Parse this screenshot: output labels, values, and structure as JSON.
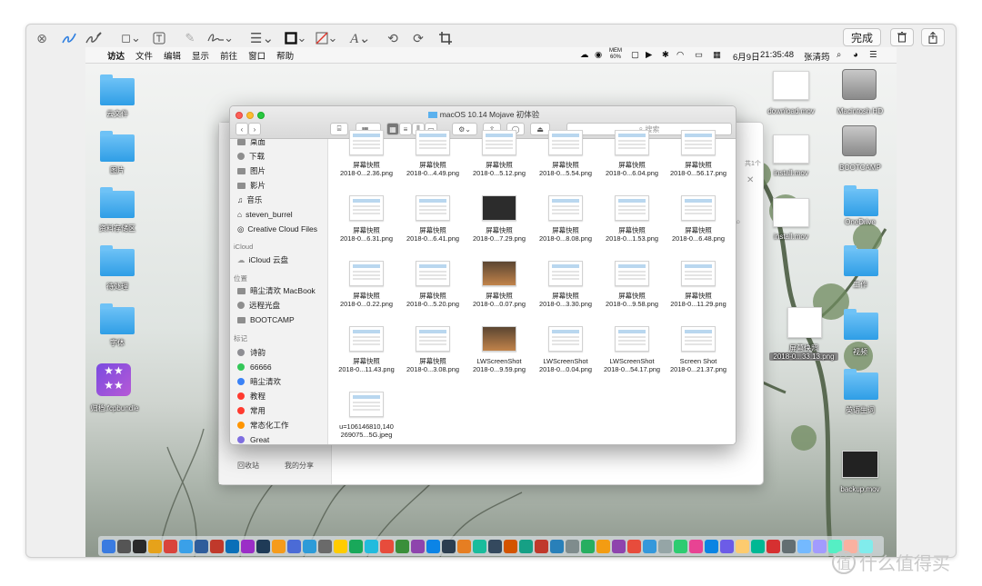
{
  "toolbar": {
    "done_label": "完成"
  },
  "menubar": {
    "items": [
      "访达",
      "文件",
      "编辑",
      "显示",
      "前往",
      "窗口",
      "帮助"
    ],
    "mem_top": "MEM",
    "mem_pct": "60%",
    "date": "6月9日",
    "time": "21:35:48",
    "user": "张清筠"
  },
  "desktop": {
    "left_icons": [
      {
        "label": "云文件"
      },
      {
        "label": "图片"
      },
      {
        "label": "资料存储区"
      },
      {
        "label": "待处理"
      },
      {
        "label": "字体"
      },
      {
        "label": "归档.fcpbundle"
      }
    ],
    "right_items": [
      {
        "label": "download.mov"
      },
      {
        "label": "Macintosh HD"
      },
      {
        "label": "install.mov"
      },
      {
        "label": "BOOTCAMP"
      },
      {
        "label": "install.mov"
      },
      {
        "label": "OneDrive"
      },
      {
        "label": "工作"
      },
      {
        "label": "屏幕快照"
      },
      {
        "label": "2018-0...33.13.png"
      },
      {
        "label": "视频"
      },
      {
        "label": "英语生词"
      },
      {
        "label": "backup.mov"
      }
    ]
  },
  "bg_window": {
    "side_footer": [
      "回收站",
      "我的分享"
    ],
    "count_text": "共1个"
  },
  "finder": {
    "title": "macOS 10.14 Mojave 初体验",
    "search_placeholder": "搜索",
    "sidebar": {
      "favorites": [
        "桌面",
        "下载",
        "图片",
        "影片",
        "音乐",
        "steven_burrel",
        "Creative Cloud Files"
      ],
      "icloud_header": "iCloud",
      "icloud": [
        "iCloud 云盘"
      ],
      "locations_header": "位置",
      "locations": [
        "暗尘清欢 MacBook",
        "远程光盘",
        "BOOTCAMP"
      ],
      "tags_header": "标记",
      "tags": [
        {
          "name": "诗韵",
          "color": "#8e8e93"
        },
        {
          "name": "66666",
          "color": "#34c759"
        },
        {
          "name": "暗尘清欢",
          "color": "#3b82f6"
        },
        {
          "name": "教程",
          "color": "#ff3b30"
        },
        {
          "name": "常用",
          "color": "#ff3b30"
        },
        {
          "name": "常态化工作",
          "color": "#ff9500"
        },
        {
          "name": "Great",
          "color": "#7e6ee0"
        }
      ]
    },
    "files": [
      {
        "name": "屏幕快照",
        "sub": "2018-0...2.36.png"
      },
      {
        "name": "屏幕快照",
        "sub": "2018-0...4.49.png"
      },
      {
        "name": "屏幕快照",
        "sub": "2018-0...5.12.png"
      },
      {
        "name": "屏幕快照",
        "sub": "2018-0...5.54.png"
      },
      {
        "name": "屏幕快照",
        "sub": "2018-0...6.04.png"
      },
      {
        "name": "屏幕快照",
        "sub": "2018-0...56.17.png"
      },
      {
        "name": "屏幕快照",
        "sub": "2018-0...6.31.png"
      },
      {
        "name": "屏幕快照",
        "sub": "2018-0...6.41.png"
      },
      {
        "name": "屏幕快照",
        "sub": "2018-0...7.29.png"
      },
      {
        "name": "屏幕快照",
        "sub": "2018-0...8.08.png"
      },
      {
        "name": "屏幕快照",
        "sub": "2018-0...1.53.png"
      },
      {
        "name": "屏幕快照",
        "sub": "2018-0...6.48.png"
      },
      {
        "name": "屏幕快照",
        "sub": "2018-0...0.22.png"
      },
      {
        "name": "屏幕快照",
        "sub": "2018-0...5.20.png"
      },
      {
        "name": "屏幕快照",
        "sub": "2018-0...0.07.png"
      },
      {
        "name": "屏幕快照",
        "sub": "2018-0...3.30.png"
      },
      {
        "name": "屏幕快照",
        "sub": "2018-0...9.58.png"
      },
      {
        "name": "屏幕快照",
        "sub": "2018-0...11.29.png"
      },
      {
        "name": "屏幕快照",
        "sub": "2018-0...11.43.png"
      },
      {
        "name": "屏幕快照",
        "sub": "2018-0...3.08.png"
      },
      {
        "name": "LWScreenShot",
        "sub": "2018-0...9.59.png"
      },
      {
        "name": "LWScreenShot",
        "sub": "2018-0...0.04.png"
      },
      {
        "name": "LWScreenShot",
        "sub": "2018-0...54.17.png"
      },
      {
        "name": "Screen Shot",
        "sub": "2018-0...21.37.png"
      },
      {
        "name": "u=106146810,140",
        "sub": "269075...5G.jpeg"
      }
    ]
  },
  "watermark": {
    "text": "什么值得买"
  }
}
